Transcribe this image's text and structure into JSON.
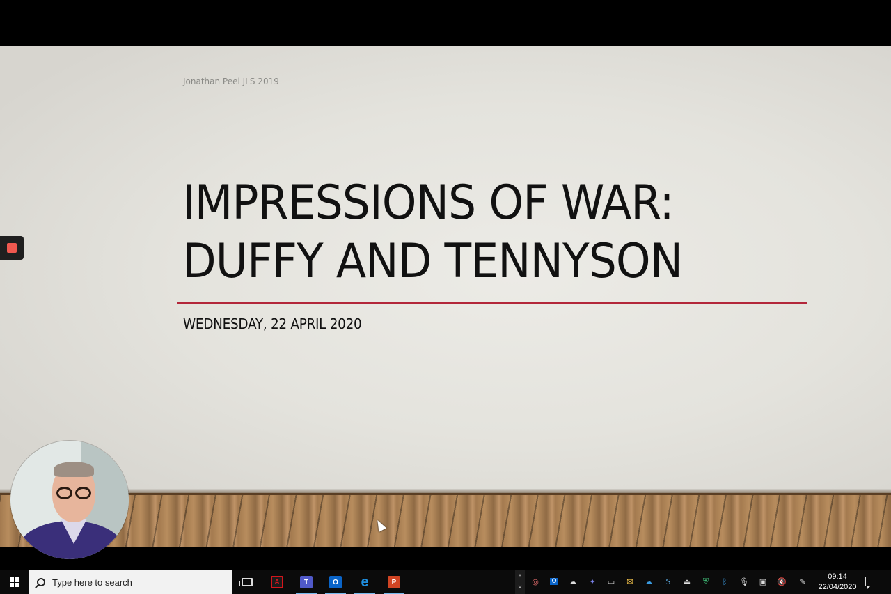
{
  "slide": {
    "author": "Jonathan Peel JLS 2019",
    "title_line1": "IMPRESSIONS OF WAR:",
    "title_line2": "DUFFY AND TENNYSON",
    "subtitle": "WEDNESDAY, 22 APRIL 2020",
    "accent_color": "#b3273a"
  },
  "recorder": {
    "icon": "record-stop-icon",
    "color": "#f0584f"
  },
  "taskbar": {
    "search_placeholder": "Type here to search",
    "apps": [
      {
        "name": "task-view",
        "icon": "task-view-icon",
        "label": ""
      },
      {
        "name": "acrobat",
        "icon": "acrobat-icon",
        "label": "A",
        "color": "#d4161c"
      },
      {
        "name": "teams",
        "icon": "teams-icon",
        "label": "T",
        "color": "#5059c9"
      },
      {
        "name": "outlook",
        "icon": "outlook-icon",
        "label": "O",
        "color": "#0a64c8"
      },
      {
        "name": "edge",
        "icon": "edge-icon",
        "label": "e",
        "color": "#1f8fe0"
      },
      {
        "name": "powerpoint",
        "icon": "powerpoint-icon",
        "label": "P",
        "color": "#d04423"
      }
    ],
    "clock_time": "09:14",
    "clock_date": "22/04/2020"
  }
}
